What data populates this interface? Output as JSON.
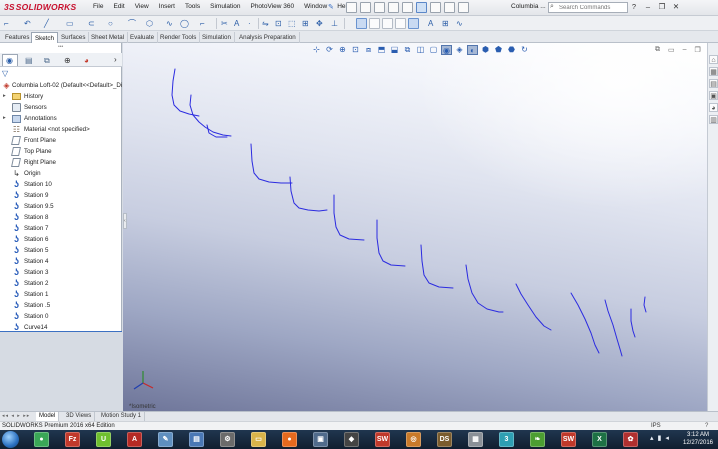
{
  "app": {
    "logo": "SOLIDWORKS",
    "logo_prefix": "3S",
    "menu": [
      "File",
      "Edit",
      "View",
      "Insert",
      "Tools",
      "Simulation",
      "PhotoView 360",
      "Window",
      "Help"
    ],
    "document_short": "Columbia ...",
    "search_placeholder": "Search Commands",
    "window_controls": [
      "?",
      "–",
      "❐",
      "✕"
    ]
  },
  "command_tabs": [
    {
      "label": "Features"
    },
    {
      "label": "Sketch",
      "active": true
    },
    {
      "label": "Surfaces"
    },
    {
      "label": "Sheet Metal"
    },
    {
      "label": "Evaluate"
    },
    {
      "label": "Render Tools"
    },
    {
      "label": "Simulation"
    },
    {
      "label": "Analysis Preparation"
    }
  ],
  "feature_tree": {
    "root": "Columbia Loft-02  (Default<<Default>_Di",
    "items": [
      {
        "label": "History",
        "icon": "folder-icon",
        "expandable": true
      },
      {
        "label": "Sensors",
        "icon": "sensor-icon",
        "expandable": false
      },
      {
        "label": "Annotations",
        "icon": "annotations-icon",
        "expandable": true
      },
      {
        "label": "Material <not specified>",
        "icon": "material-icon",
        "expandable": false
      },
      {
        "label": "Front Plane",
        "icon": "plane-icon",
        "expandable": false
      },
      {
        "label": "Top Plane",
        "icon": "plane-icon",
        "expandable": false
      },
      {
        "label": "Right Plane",
        "icon": "plane-icon",
        "expandable": false
      },
      {
        "label": "Origin",
        "icon": "origin-icon",
        "expandable": false
      },
      {
        "label": "Station 10",
        "icon": "sketch-icon",
        "expandable": false
      },
      {
        "label": "Station 9",
        "icon": "sketch-icon",
        "expandable": false
      },
      {
        "label": "Station 9.5",
        "icon": "sketch-icon",
        "expandable": false
      },
      {
        "label": "Station 8",
        "icon": "sketch-icon",
        "expandable": false
      },
      {
        "label": "Station 7",
        "icon": "sketch-icon",
        "expandable": false
      },
      {
        "label": "Station 6",
        "icon": "sketch-icon",
        "expandable": false
      },
      {
        "label": "Station 5",
        "icon": "sketch-icon",
        "expandable": false
      },
      {
        "label": "Station 4",
        "icon": "sketch-icon",
        "expandable": false
      },
      {
        "label": "Station 3",
        "icon": "sketch-icon",
        "expandable": false
      },
      {
        "label": "Station 2",
        "icon": "sketch-icon",
        "expandable": false
      },
      {
        "label": "Station 1",
        "icon": "sketch-icon",
        "expandable": false
      },
      {
        "label": "Station .5",
        "icon": "sketch-icon",
        "expandable": false
      },
      {
        "label": "Station 0",
        "icon": "sketch-icon",
        "expandable": false
      },
      {
        "label": "Curve14",
        "icon": "sketch-icon",
        "expandable": false
      }
    ]
  },
  "viewport": {
    "view_label": "*Isometric",
    "sketch_color": "#2b2be0"
  },
  "bottom_tabs": [
    {
      "label": "Model",
      "active": true
    },
    {
      "label": "3D Views"
    },
    {
      "label": "Motion Study 1"
    }
  ],
  "status": {
    "text": "SOLIDWORKS Premium 2016 x64 Edition",
    "units": "IPS",
    "help": "?"
  },
  "taskbar": {
    "time": "3:12 AM",
    "date": "12/27/2016",
    "apps": [
      {
        "name": "chrome-icon",
        "color": "#3aa757",
        "glyph": "●"
      },
      {
        "name": "filezilla-icon",
        "color": "#c0392b",
        "glyph": "Fz"
      },
      {
        "name": "upwork-icon",
        "color": "#6fbf2f",
        "glyph": "U"
      },
      {
        "name": "acrobat-icon",
        "color": "#b52a25",
        "glyph": "A"
      },
      {
        "name": "notepad-icon",
        "color": "#5f8fbf",
        "glyph": "✎"
      },
      {
        "name": "document-icon",
        "color": "#4a78b5",
        "glyph": "▤"
      },
      {
        "name": "settings-icon",
        "color": "#6b6b6b",
        "glyph": "⚙"
      },
      {
        "name": "explorer-icon",
        "color": "#d9b44a",
        "glyph": "▭"
      },
      {
        "name": "firefox-icon",
        "color": "#e66a1f",
        "glyph": "●"
      },
      {
        "name": "monitor-icon",
        "color": "#506b8c",
        "glyph": "▣"
      },
      {
        "name": "unity-icon",
        "color": "#444444",
        "glyph": "◆"
      },
      {
        "name": "solidworks-2016-icon",
        "color": "#c0392b",
        "glyph": "SW"
      },
      {
        "name": "target-icon",
        "color": "#c97a2a",
        "glyph": "◎"
      },
      {
        "name": "ds-icon",
        "color": "#7a5c2e",
        "glyph": "DS"
      },
      {
        "name": "calculator-icon",
        "color": "#8a9097",
        "glyph": "▦"
      },
      {
        "name": "three-icon",
        "color": "#2e9fb3",
        "glyph": "3"
      },
      {
        "name": "leaf-icon",
        "color": "#4c9e32",
        "glyph": "❧"
      },
      {
        "name": "solidworks-icon",
        "color": "#c0392b",
        "glyph": "SW"
      },
      {
        "name": "excel-icon",
        "color": "#1e7145",
        "glyph": "X"
      },
      {
        "name": "record-icon",
        "color": "#b03030",
        "glyph": "✿"
      }
    ]
  }
}
